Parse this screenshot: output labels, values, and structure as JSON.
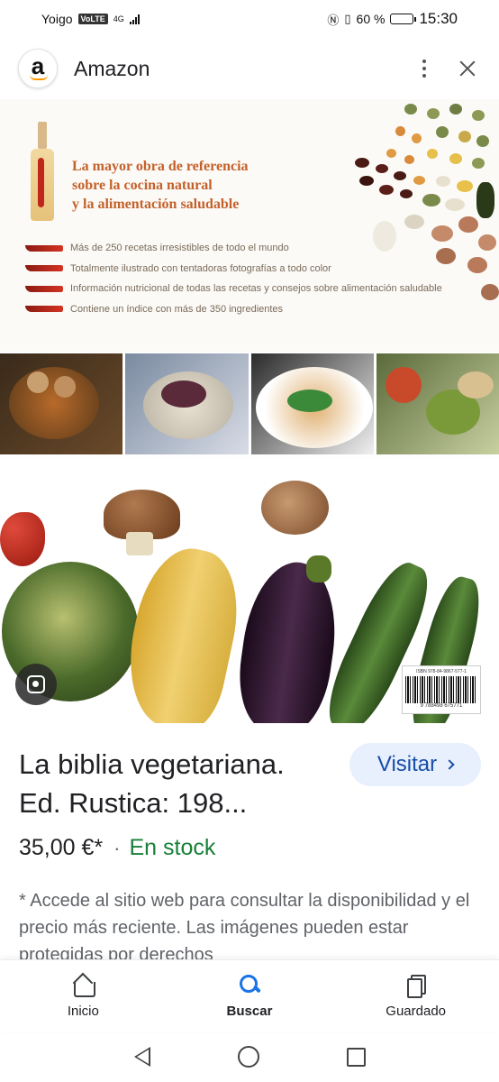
{
  "status_bar": {
    "carrier": "Yoigo",
    "volte": "VoLTE",
    "network": "4G",
    "battery": "60 %",
    "battery_level": 0.6,
    "time": "15:30"
  },
  "header": {
    "site_logo_letter": "a",
    "site_name": "Amazon",
    "icons": [
      "amazon-logo-icon",
      "more-vert-icon",
      "close-icon"
    ]
  },
  "cover": {
    "headline": [
      "La mayor obra de referencia",
      "sobre la cocina natural",
      "y la alimentación saludable"
    ],
    "bullets": [
      "Más de 250 recetas irresistibles de todo el mundo",
      "Totalmente ilustrado con tentadoras fotografías a todo color",
      "Información nutricional de todas las recetas y consejos sobre alimentación saludable",
      "Contiene un índice con más de 350 ingredientes"
    ],
    "barcode_isbn": "ISBN 978-84-9867-577-1",
    "barcode_number": "9 788498 675771",
    "colors": {
      "headline": "#c5602a",
      "bullets": "#7b6a5a"
    }
  },
  "product": {
    "title_line1": "La biblia vegetariana.",
    "title_line2": "Ed. Rustica: 198...",
    "visit_label": "Visitar",
    "price": "35,00 €*",
    "separator": "·",
    "stock": "En stock",
    "disclaimer": "* Accede al sitio web para consultar la disponibilidad y el precio más reciente. Las imágenes pueden estar protegidas por derechos",
    "colors": {
      "stock": "#188038",
      "visit_bg": "#e8f0fe",
      "visit_text": "#174ea6"
    }
  },
  "bottom_nav": {
    "items": [
      {
        "label": "Inicio",
        "icon": "home-icon"
      },
      {
        "label": "Buscar",
        "icon": "search-icon",
        "active": true
      },
      {
        "label": "Guardado",
        "icon": "saved-icon"
      }
    ]
  },
  "system_nav": {
    "icons": [
      "back-icon",
      "home-circle-icon",
      "recents-icon"
    ]
  }
}
